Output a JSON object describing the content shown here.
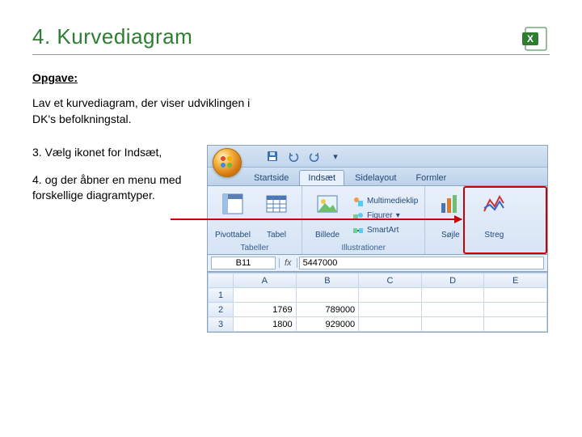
{
  "title": "4. Kurvediagram",
  "subhead": "Opgave:",
  "task": "Lav et kurvediagram, der viser udviklingen i DK's befolkningstal.",
  "step3": "3. Vælg ikonet for Indsæt,",
  "step4": "4. og der åbner en menu med forskellige diagramtyper.",
  "excel": {
    "tabs": {
      "home": "Startside",
      "insert": "Indsæt",
      "layout": "Sidelayout",
      "formulas": "Formler"
    },
    "ribbon": {
      "group_tables_label": "Tabeller",
      "group_illustrations_label": "Illustrationer",
      "btn_pivot": "Pivottabel",
      "btn_table": "Tabel",
      "btn_picture": "Billede",
      "btn_clipart": "Multimedieklip",
      "btn_shapes": "Figurer",
      "btn_smartart": "SmartArt",
      "btn_column": "Søjle",
      "btn_line": "Streg"
    },
    "name_box": "B11",
    "fx_label": "fx",
    "formula_value": "5447000",
    "columns": [
      "A",
      "B",
      "C",
      "D",
      "E"
    ],
    "rows": [
      {
        "hdr": "1",
        "cells": [
          "",
          "",
          "",
          "",
          ""
        ]
      },
      {
        "hdr": "2",
        "cells": [
          "1769",
          "789000",
          "",
          "",
          ""
        ]
      },
      {
        "hdr": "3",
        "cells": [
          "1800",
          "929000",
          "",
          "",
          ""
        ]
      }
    ]
  }
}
